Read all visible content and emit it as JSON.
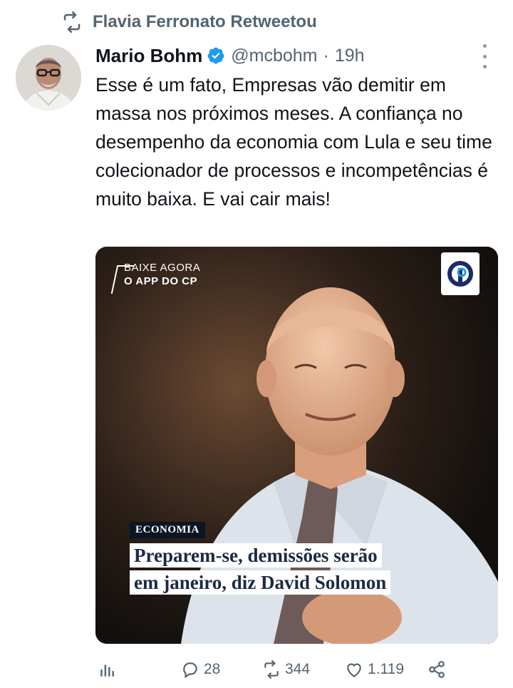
{
  "retweet": {
    "icon": "retweet-icon",
    "text": "Flavia Ferronato Retweetou"
  },
  "tweet": {
    "author_name": "Mario Bohm",
    "verified": true,
    "handle": "@mcbohm",
    "separator": "·",
    "time": "19h",
    "text": "Esse é um fato, Empresas vão demitir em massa nos próximos meses. A confiança no desempenho da economia com Lula e seu time colecionador de processos e incompetências é muito baixa. E vai cair mais!"
  },
  "media": {
    "promo_line1": "BAIXE AGORA",
    "promo_line2": "O APP DO CP",
    "tag": "ECONOMIA",
    "headline_line1": "Preparem-se, demissões serão",
    "headline_line2": "em janeiro, diz David Solomon"
  },
  "actions": {
    "views_icon": "analytics-icon",
    "replies": "28",
    "retweets": "344",
    "likes": "1.119",
    "share_icon": "share-icon"
  },
  "colors": {
    "text_primary": "#0f1419",
    "text_secondary": "#536471",
    "verified_blue": "#1d9bf0"
  }
}
